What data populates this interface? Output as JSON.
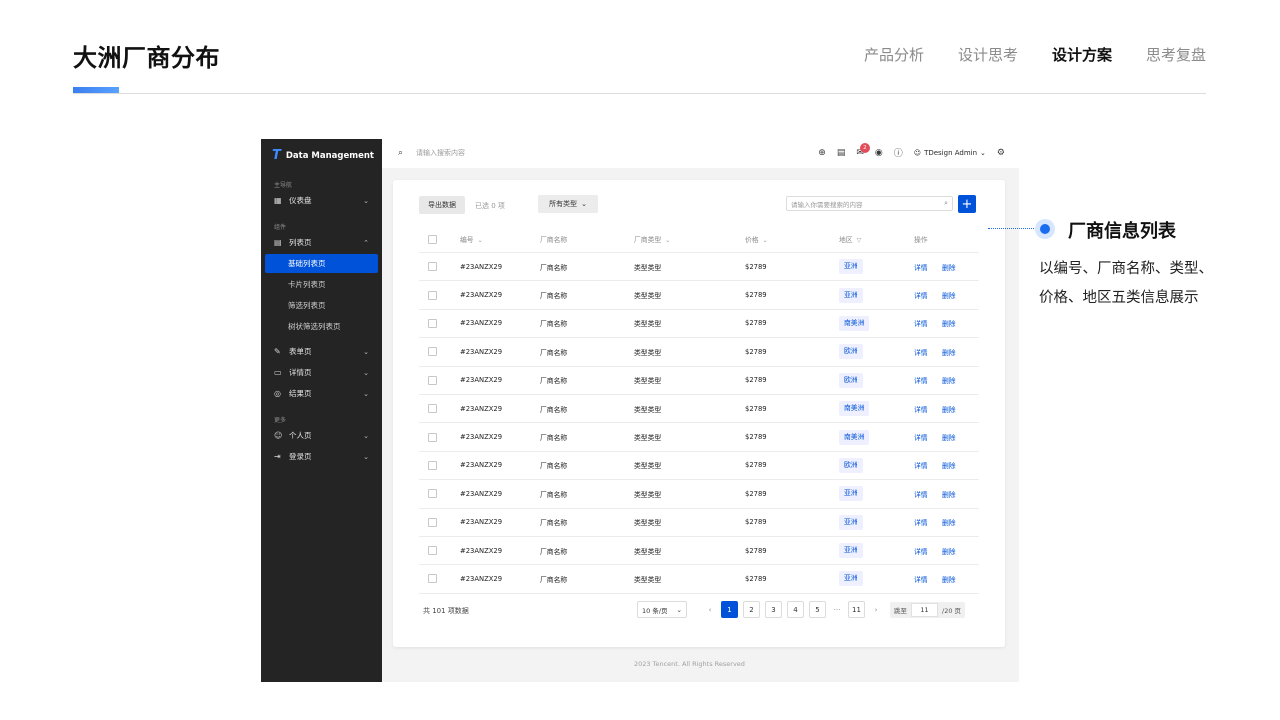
{
  "slide": {
    "title": "大洲厂商分布",
    "nav": [
      "产品分析",
      "设计思考",
      "设计方案",
      "思考复盘"
    ],
    "active_nav": "设计方案"
  },
  "callout": {
    "title": "厂商信息列表",
    "desc_line1": "以编号、厂商名称、类型、",
    "desc_line2": "价格、地区五类信息展示"
  },
  "app": {
    "logo_mark": "T",
    "logo_text": "Data Management",
    "sidebar": {
      "group_main": "主导航",
      "group_components": "组件",
      "group_more": "更多",
      "dashboard": "仪表盘",
      "list": "列表页",
      "list_basic": "基础列表页",
      "list_card": "卡片列表页",
      "list_filter": "筛选列表页",
      "list_tree": "树状筛选列表页",
      "form": "表单页",
      "detail": "详情页",
      "result": "结果页",
      "personal": "个人页",
      "login": "登录页"
    },
    "topbar": {
      "search_placeholder": "请输入搜索内容",
      "notification_count": "2",
      "user": "TDesign Admin"
    },
    "toolbar": {
      "export_label": "导出数据",
      "selected_text": "已选 0 项",
      "type_select": "所有类型",
      "search_placeholder": "请输入你需要搜索的内容",
      "add_label": "+"
    },
    "table": {
      "headers": {
        "no": "编号",
        "name": "厂商名称",
        "type": "厂商类型",
        "price": "价格",
        "region": "地区",
        "ops": "操作"
      },
      "detail_label": "详情",
      "delete_label": "删除",
      "rows": [
        {
          "no": "#23ANZX29",
          "name": "厂商名称",
          "type": "类型类型",
          "price": "$2789",
          "region": "亚洲"
        },
        {
          "no": "#23ANZX29",
          "name": "厂商名称",
          "type": "类型类型",
          "price": "$2789",
          "region": "亚洲"
        },
        {
          "no": "#23ANZX29",
          "name": "厂商名称",
          "type": "类型类型",
          "price": "$2789",
          "region": "南美洲"
        },
        {
          "no": "#23ANZX29",
          "name": "厂商名称",
          "type": "类型类型",
          "price": "$2789",
          "region": "欧洲"
        },
        {
          "no": "#23ANZX29",
          "name": "厂商名称",
          "type": "类型类型",
          "price": "$2789",
          "region": "欧洲"
        },
        {
          "no": "#23ANZX29",
          "name": "厂商名称",
          "type": "类型类型",
          "price": "$2789",
          "region": "南美洲"
        },
        {
          "no": "#23ANZX29",
          "name": "厂商名称",
          "type": "类型类型",
          "price": "$2789",
          "region": "南美洲"
        },
        {
          "no": "#23ANZX29",
          "name": "厂商名称",
          "type": "类型类型",
          "price": "$2789",
          "region": "欧洲"
        },
        {
          "no": "#23ANZX29",
          "name": "厂商名称",
          "type": "类型类型",
          "price": "$2789",
          "region": "亚洲"
        },
        {
          "no": "#23ANZX29",
          "name": "厂商名称",
          "type": "类型类型",
          "price": "$2789",
          "region": "亚洲"
        },
        {
          "no": "#23ANZX29",
          "name": "厂商名称",
          "type": "类型类型",
          "price": "$2789",
          "region": "亚洲"
        },
        {
          "no": "#23ANZX29",
          "name": "厂商名称",
          "type": "类型类型",
          "price": "$2789",
          "region": "亚洲"
        }
      ]
    },
    "pagination": {
      "total": "共 101 项数据",
      "page_size": "10 条/页",
      "pages": [
        "1",
        "2",
        "3",
        "4",
        "5"
      ],
      "ellipsis": "···",
      "last_page": "11",
      "current": "1",
      "jump_label": "跳至",
      "jump_value": "11",
      "page_count": "/20 页"
    },
    "copyright": "2023 Tencent. All Rights Reserved"
  },
  "colors": {
    "brand": "#0052d9",
    "sidebar_bg": "#242424",
    "accent_bar": "#3b7ef0"
  }
}
